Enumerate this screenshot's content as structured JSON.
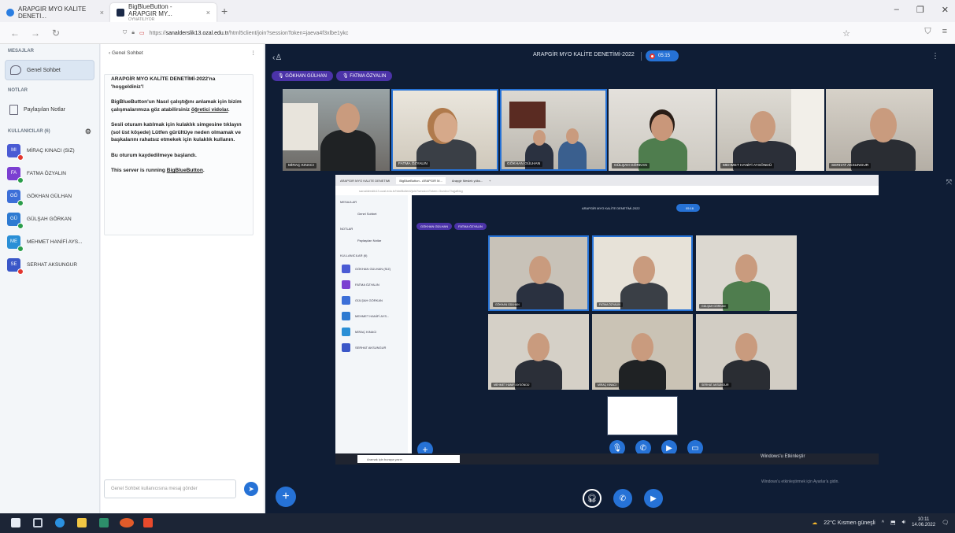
{
  "browser": {
    "tabs": [
      {
        "title": "ARAPGIR MYO KALITE DENETI..."
      },
      {
        "title": "BigBlueButton - ARAPGIR MY...",
        "subtitle": "OYNATILIYOR"
      }
    ],
    "url_prefix": "https://",
    "url_host": "sanalderslik13.ozal.edu.tr",
    "url_path": "/html5client/join?sessionToken=jaeva4f3xlbe1ykc"
  },
  "sidebar": {
    "messages_title": "MESAJLAR",
    "public_chat": "Genel Sohbet",
    "notes_title": "NOTLAR",
    "shared_notes": "Paylaşılan Notlar",
    "users_title": "KULLANICILAR (6)",
    "users": [
      {
        "initials": "Mi",
        "name": "MİRAÇ KINACI (Siz)",
        "color": "#4a5bd4",
        "status": "#e2362f"
      },
      {
        "initials": "Fa",
        "name": "FATMA ÖZYALIN",
        "color": "#7b3fd1",
        "status": "#2a9d4a"
      },
      {
        "initials": "Gö",
        "name": "GÖKHAN GÜLHAN",
        "color": "#3c6fd8",
        "status": "#2a9d4a"
      },
      {
        "initials": "Gü",
        "name": "GÜLŞAH GÖRKAN",
        "color": "#2d7ad1",
        "status": "#2a9d4a"
      },
      {
        "initials": "Me",
        "name": "MEHMET HANİFİ AYS...",
        "color": "#2a8fd6",
        "status": "#2a9d4a"
      },
      {
        "initials": "Se",
        "name": "SERHAT AKSUNGUR",
        "color": "#3a57c8",
        "status": "#e2362f"
      }
    ]
  },
  "chat": {
    "back_label": "‹ Genel Sohbet",
    "welcome_line1": "ARAPGİR MYO KALİTE DENETİMİ-2022'na 'hoşgeldiniz'!",
    "welcome_line2a": "BigBlueButton'un Nasıl çalıştığını anlamak için bizim çalışmalarımıza göz atabilirsiniz ",
    "welcome_link": "öğretici vidolar",
    "welcome_line2b": ".",
    "welcome_line3": "Sesli oturam katılmak için kulaklık simgesine tıklayın (sol üst köşede) Lütfen gürültüye neden olmamak ve başkalarını rahatsız etmekek için kulaklık kullanın.",
    "recording_note": "Bu oturum kaydedilmeye başlandı.",
    "server_prefix": "This server is running ",
    "server_link": "BigBlueButton",
    "server_suffix": ".",
    "input_placeholder": "Genel Sohbet kullanıcısına mesaj gönder"
  },
  "stage": {
    "title": "ARAPGİR MYO KALİTE DENETİMİ-2022",
    "rec_time": "05:15",
    "talkers": [
      "GÖKHAN GÜLHAN",
      "FATMA ÖZYALIN"
    ],
    "tiles": [
      "MİRAÇ KINACI",
      "FATMA ÖZYALIN",
      "GÖKHAN GÜLHAN",
      "GÜLŞAH GÖRKAN",
      "MEHMET HANİFİ AYSÖNDÜ",
      "SERHAT AKSUNGUR"
    ]
  },
  "inner": {
    "tab1": "ARAPGIR MYO KALITE DENETIMI",
    "tab2": "BigBlueButton - ARAPGIR M...",
    "tab3": "Arapgir Meslek yüks...",
    "url": "sanalderslik13.ozal.edu.tr/html5client/join?sessionToken=3xzdxo7hqjafbkg",
    "title": "ARAPGİR MYO KALİTE DENETİMİ-2022",
    "rec_time": "05:16",
    "talkers": [
      "GÖKHAN GÜLHAN",
      "FATMA ÖZYALIN"
    ],
    "messages_title": "MESAJLAR",
    "public_chat": "Genel Sohbet",
    "notes_title": "NOTLAR",
    "shared_notes": "Paylaşılan Notlar",
    "users_title": "KULLANICILAR (6)",
    "users": [
      "GÖKHAN GÜLHAN (Siz)",
      "FATMA ÖZYALIN",
      "GÜLŞAH GÖRKAN",
      "MEHMET HANİFİ AYS...",
      "MİRAÇ KINACI",
      "SERHAT AKSUNGUR"
    ],
    "tiles": [
      "GÖKHAN GÜLHAN",
      "FATMA ÖZYALIN",
      "GÜLŞAH GÖRKAN",
      "MEHMET HANİFİ AYSÖNDÜ",
      "MİRAÇ KINACI",
      "SERHAT AKSUNGUR"
    ],
    "search_placeholder": "Aramak için buraya yazın",
    "activate_title": "Windows'u Etkinleştir",
    "activate_sub": "Windows'u etkinleştirmek için Ayarlar'a gidin."
  },
  "taskbar": {
    "weather": "22°C Kısmen güneşli",
    "time": "10:11",
    "date": "14.06.2022"
  },
  "colors": {
    "accent": "#2672d6",
    "stage_bg": "#0f1d35",
    "talker": "#4b33a8",
    "recording": "#e2362f"
  }
}
